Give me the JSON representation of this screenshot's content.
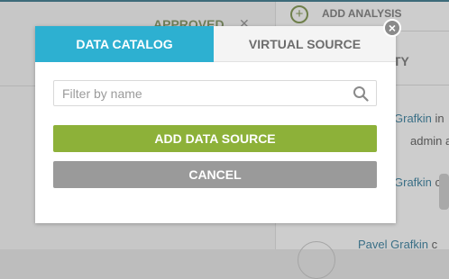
{
  "background": {
    "status_label": "APPROVED",
    "add_analysis_label": "ADD ANALYSIS",
    "panel_header_fragment": "TY",
    "activity": [
      {
        "name": "Grafkin",
        "rest": " in"
      },
      {
        "name": "",
        "rest": "admin ad"
      },
      {
        "name": "Grafkin",
        "rest": " cr"
      },
      {
        "name": "Pavel Grafkin",
        "rest": " c"
      }
    ]
  },
  "modal": {
    "tabs": [
      {
        "label": "DATA CATALOG",
        "active": true
      },
      {
        "label": "VIRTUAL SOURCE",
        "active": false
      }
    ],
    "search": {
      "placeholder": "Filter by name",
      "value": ""
    },
    "add_button_label": "ADD DATA SOURCE",
    "cancel_button_label": "CANCEL",
    "close_glyph": "×"
  },
  "colors": {
    "accent_tab": "#2db0d1",
    "add_button": "#8db139",
    "cancel_button": "#9a9a9a"
  },
  "icons": [
    "search-icon",
    "close-icon",
    "add-circle-icon",
    "chevron-down-icon"
  ]
}
